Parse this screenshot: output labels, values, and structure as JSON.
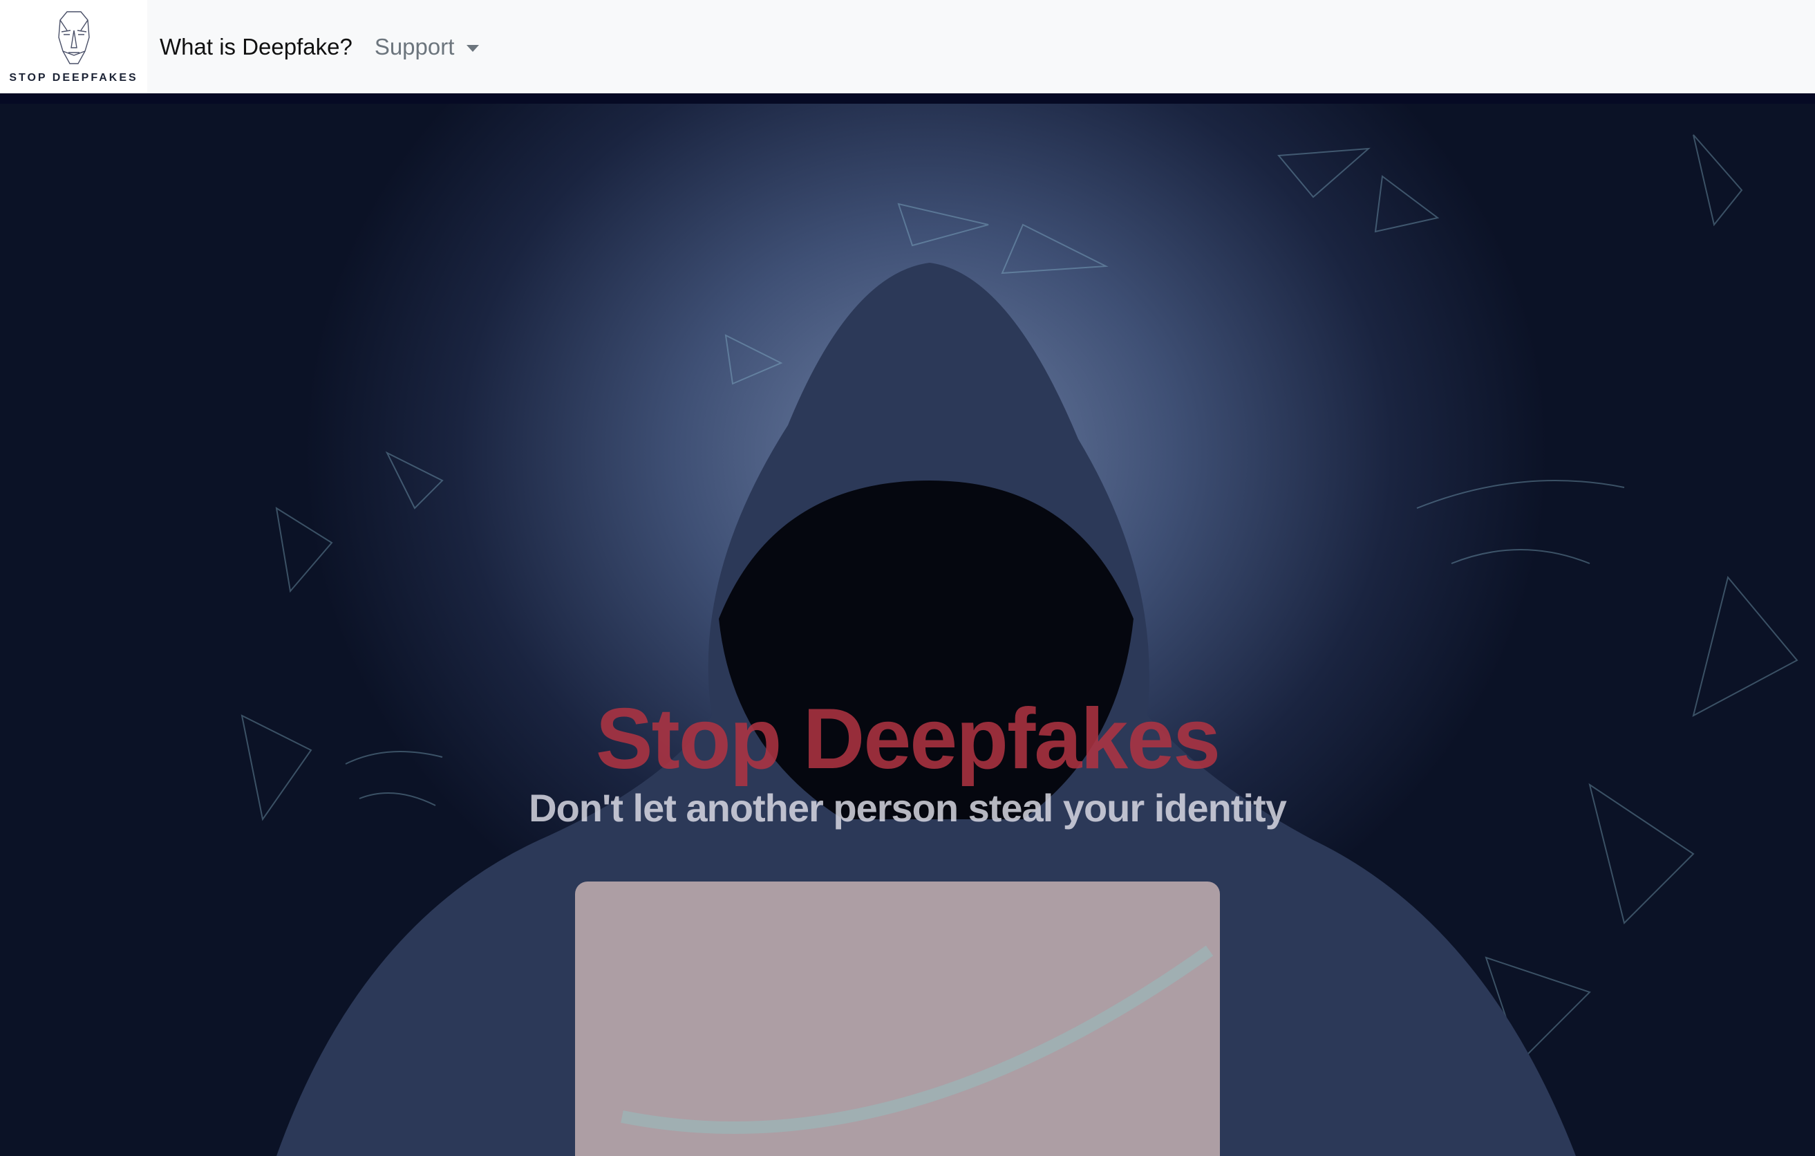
{
  "navbar": {
    "brand_text": "STOP DEEPFAKES",
    "links": [
      {
        "label": "What is Deepfake?"
      },
      {
        "label": "Support"
      }
    ]
  },
  "hero": {
    "title": "Stop Deepfakes",
    "subtitle": "Don't let another person steal your identity",
    "title_color": "#b23442"
  }
}
